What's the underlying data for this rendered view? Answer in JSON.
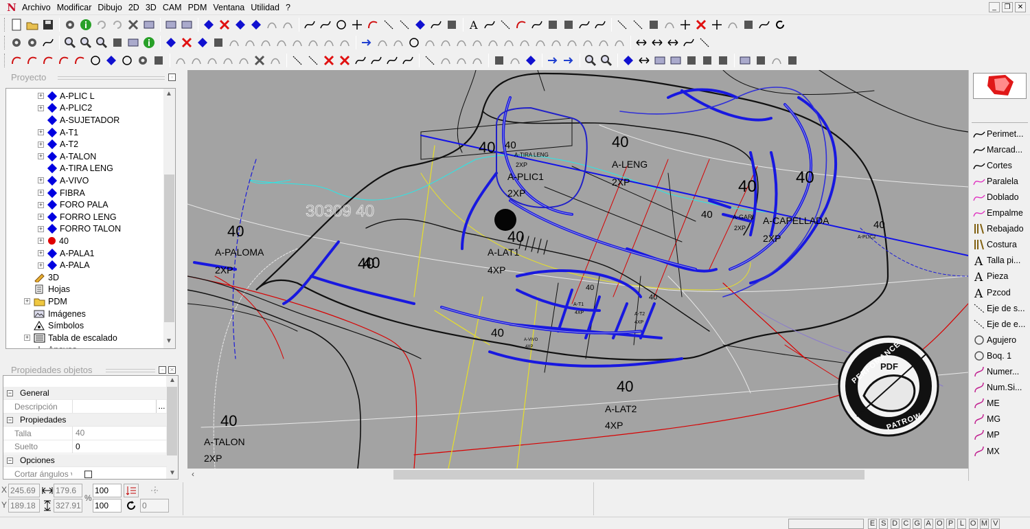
{
  "menubar": {
    "logo": "N",
    "items": [
      "Archivo",
      "Modificar",
      "Dibujo",
      "2D",
      "3D",
      "CAM",
      "PDM",
      "Ventana",
      "Utilidad",
      "?"
    ],
    "controls": [
      "_",
      "❐",
      "✕"
    ]
  },
  "project_panel": {
    "title": "Proyecto",
    "items": [
      {
        "label": "A-PLIC L",
        "icon": "diamond-icon",
        "expand": true,
        "indent": 1
      },
      {
        "label": "A-PLIC2",
        "icon": "diamond-icon",
        "expand": true,
        "indent": 1
      },
      {
        "label": "A-SUJETADOR",
        "icon": "diamond-icon",
        "expand": false,
        "indent": 1
      },
      {
        "label": "A-T1",
        "icon": "diamond-icon",
        "expand": true,
        "indent": 1
      },
      {
        "label": "A-T2",
        "icon": "diamond-icon",
        "expand": true,
        "indent": 1
      },
      {
        "label": "A-TALON",
        "icon": "diamond-icon",
        "expand": true,
        "indent": 1
      },
      {
        "label": "A-TIRA LENG",
        "icon": "diamond-icon",
        "expand": false,
        "indent": 1
      },
      {
        "label": "A-VIVO",
        "icon": "diamond-icon",
        "expand": true,
        "indent": 1
      },
      {
        "label": "FIBRA",
        "icon": "diamond-icon",
        "expand": true,
        "indent": 1
      },
      {
        "label": "FORO PALA",
        "icon": "diamond-icon",
        "expand": true,
        "indent": 1
      },
      {
        "label": "FORRO LENG",
        "icon": "diamond-icon",
        "expand": true,
        "indent": 1
      },
      {
        "label": "FORRO TALON",
        "icon": "diamond-icon",
        "expand": true,
        "indent": 1
      },
      {
        "label": "40",
        "icon": "red-dot-icon",
        "expand": true,
        "indent": 1
      },
      {
        "label": "A-PALA1",
        "icon": "diamond-icon",
        "expand": true,
        "indent": 1
      },
      {
        "label": "A-PALA",
        "icon": "diamond-icon",
        "expand": true,
        "indent": 1
      },
      {
        "label": "3D",
        "icon": "pencil-3d-icon",
        "expand": false,
        "indent": 0
      },
      {
        "label": "Hojas",
        "icon": "sheets-icon",
        "expand": false,
        "indent": 0
      },
      {
        "label": "PDM",
        "icon": "folder-icon",
        "expand": true,
        "indent": 0
      },
      {
        "label": "Imágenes",
        "icon": "images-icon",
        "expand": false,
        "indent": 0
      },
      {
        "label": "Símbolos",
        "icon": "symbols-icon",
        "expand": false,
        "indent": 0
      },
      {
        "label": "Tabla de escalado",
        "icon": "scale-table-icon",
        "expand": true,
        "indent": 0
      },
      {
        "label": "Apoyos",
        "icon": "supports-icon",
        "expand": false,
        "indent": 0
      }
    ]
  },
  "properties_panel": {
    "title": "Propiedades objetos",
    "rows": [
      {
        "type": "group",
        "label": "General"
      },
      {
        "type": "prop",
        "label": "Descripción",
        "value": "",
        "button": "..."
      },
      {
        "type": "group",
        "label": "Propiedades"
      },
      {
        "type": "prop",
        "label": "Talla",
        "value": "40",
        "dim": true
      },
      {
        "type": "prop",
        "label": "Suelto",
        "value": "0"
      },
      {
        "type": "group",
        "label": "Opciones"
      },
      {
        "type": "prop",
        "label": "Cortar ángulos vivos",
        "value": "",
        "checkbox": true
      }
    ]
  },
  "coords": {
    "x_label": "X",
    "y_label": "Y",
    "x": "245.69",
    "y": "189.18",
    "width": "179.6",
    "height": "327.91",
    "percent": "%",
    "scale1": "100",
    "scale2": "100",
    "angle": "0"
  },
  "canvas": {
    "background": "#a3a3a3",
    "labels": [
      {
        "text": "40",
        "size": 22,
        "bold": false
      },
      {
        "text": "A-PALOMA"
      },
      {
        "text": "2XP"
      },
      {
        "text": "40"
      },
      {
        "text": "30309 40"
      },
      {
        "text": "A-PLIC1"
      },
      {
        "text": "2XP"
      },
      {
        "text": "40"
      },
      {
        "text": "40"
      },
      {
        "text": "A-TIRA LENG"
      },
      {
        "text": "2XP"
      },
      {
        "text": "40"
      },
      {
        "text": "A-LENG"
      },
      {
        "text": "2XP"
      },
      {
        "text": "40"
      },
      {
        "text": "40"
      },
      {
        "text": "A-CAPELLADA"
      },
      {
        "text": "2XP"
      },
      {
        "text": "A-GARI"
      },
      {
        "text": "2XP"
      },
      {
        "text": "40"
      },
      {
        "text": "40"
      },
      {
        "text": "A-LAT1"
      },
      {
        "text": "4XP"
      },
      {
        "text": "40"
      },
      {
        "text": "40"
      },
      {
        "text": "A-T1"
      },
      {
        "text": "4XP"
      },
      {
        "text": "A-T2"
      },
      {
        "text": "4XP"
      },
      {
        "text": "40"
      },
      {
        "text": "40"
      },
      {
        "text": "A-VIVO"
      },
      {
        "text": "4XP"
      },
      {
        "text": "40"
      },
      {
        "text": "40"
      },
      {
        "text": "A-LAT2"
      },
      {
        "text": "4XP"
      },
      {
        "text": "40"
      },
      {
        "text": "A-TALON"
      },
      {
        "text": "2XP"
      },
      {
        "text": "A-PLIC2"
      }
    ],
    "watermark": {
      "top": "PERFOMANCE",
      "center": "PDF",
      "bottom": "PATROW"
    }
  },
  "right_panel": {
    "tools": [
      {
        "label": "Perimet...",
        "icon": "curve-icon"
      },
      {
        "label": "Marcad...",
        "icon": "curve-icon"
      },
      {
        "label": "Cortes",
        "icon": "curve-icon"
      },
      {
        "label": "Paralela",
        "icon": "pink-curve-icon"
      },
      {
        "label": "Doblado",
        "icon": "pink-curve-icon"
      },
      {
        "label": "Empalme",
        "icon": "pink-curve-icon"
      },
      {
        "label": "Rebajado",
        "icon": "rebajado-icon"
      },
      {
        "label": "Costura",
        "icon": "costura-icon"
      },
      {
        "label": "Talla pi...",
        "icon": "text-a-icon"
      },
      {
        "label": "Pieza",
        "icon": "text-a-icon"
      },
      {
        "label": "Pzcod",
        "icon": "text-a-icon"
      },
      {
        "label": "Eje de s...",
        "icon": "axis-icon"
      },
      {
        "label": "Eje de e...",
        "icon": "axis-icon"
      },
      {
        "label": "Agujero",
        "icon": "circle-icon"
      },
      {
        "label": "Boq. 1",
        "icon": "circle-icon"
      },
      {
        "label": "Numer...",
        "icon": "pink-s-icon"
      },
      {
        "label": "Num.Si...",
        "icon": "pink-s-icon"
      },
      {
        "label": "ME",
        "icon": "pink-s-icon"
      },
      {
        "label": "MG",
        "icon": "pink-s-icon"
      },
      {
        "label": "MP",
        "icon": "pink-s-icon"
      },
      {
        "label": "MX",
        "icon": "pink-s-icon"
      }
    ]
  },
  "statusbar": {
    "letters": [
      "E",
      "S",
      "D",
      "C",
      "G",
      "A",
      "O",
      "P",
      "L",
      "O",
      "M",
      "V"
    ]
  }
}
